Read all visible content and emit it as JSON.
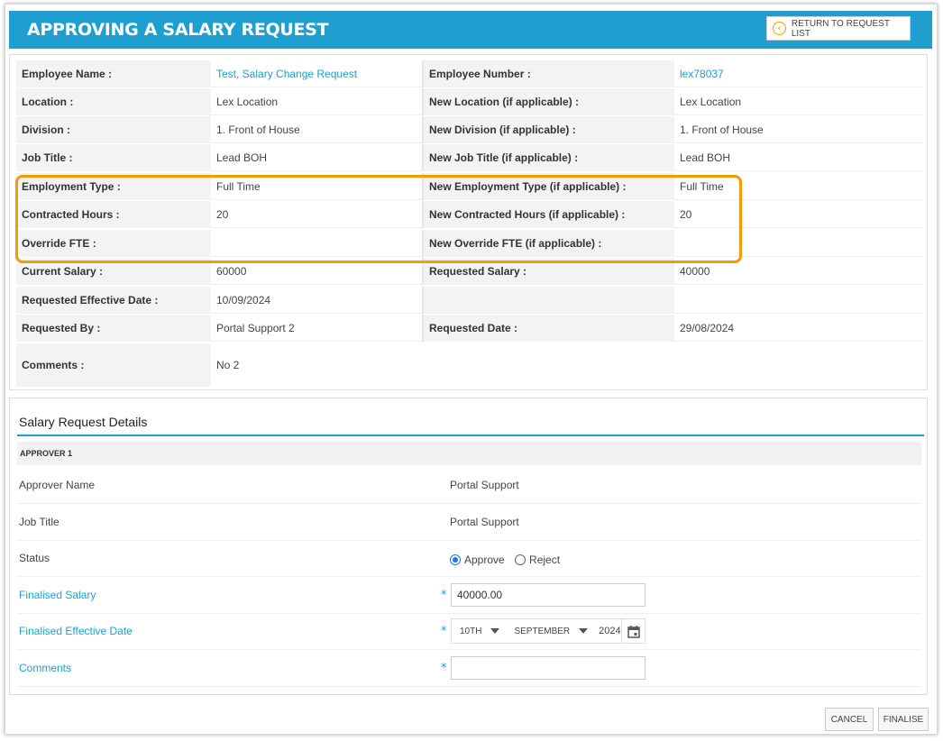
{
  "header": {
    "title": "APPROVING A SALARY REQUEST",
    "return_button": "RETURN TO REQUEST LIST"
  },
  "info": {
    "rows": [
      {
        "l1": "Employee Name :",
        "v1": "Test, Salary Change Request",
        "l2": "Employee Number :",
        "v2": "lex78037"
      },
      {
        "l1": "Location :",
        "v1": "Lex Location",
        "l2": "New Location (if applicable) :",
        "v2": "Lex Location"
      },
      {
        "l1": "Division :",
        "v1": "1. Front of House",
        "l2": "New Division (if applicable) :",
        "v2": "1. Front of House"
      },
      {
        "l1": "Job Title :",
        "v1": "Lead BOH",
        "l2": "New Job Title (if applicable) :",
        "v2": "Lead BOH"
      },
      {
        "l1": "Employment Type :",
        "v1": "Full Time",
        "l2": "New Employment Type (if applicable) :",
        "v2": "Full Time"
      },
      {
        "l1": "Contracted Hours :",
        "v1": "20",
        "l2": "New Contracted Hours (if applicable) :",
        "v2": "20"
      },
      {
        "l1": "Override FTE :",
        "v1": "",
        "l2": "New Override FTE (if applicable) :",
        "v2": ""
      },
      {
        "l1": "Current Salary :",
        "v1": "60000",
        "l2": "Requested Salary :",
        "v2": "40000"
      },
      {
        "l1": "Requested Effective Date :",
        "v1": "10/09/2024",
        "l2": "",
        "v2": ""
      },
      {
        "l1": "Requested By :",
        "v1": "Portal Support 2",
        "l2": "Requested Date :",
        "v2": "29/08/2024"
      },
      {
        "l1": "Comments :",
        "v1": "No 2",
        "l2": "",
        "v2": ""
      }
    ]
  },
  "details": {
    "title": "Salary Request Details",
    "approver_band": "APPROVER 1",
    "approver_name_label": "Approver Name",
    "approver_name": "Portal Support",
    "job_title_label": "Job Title",
    "job_title": "Portal Support",
    "status_label": "Status",
    "approve_label": "Approve",
    "reject_label": "Reject",
    "finalised_salary_label": "Finalised Salary",
    "finalised_salary": "40000.00",
    "finalised_date_label": "Finalised Effective Date",
    "date_day": "10TH",
    "date_month": "SEPTEMBER",
    "date_year": "2024",
    "comments_label": "Comments",
    "comments_value": "",
    "required_mark": "*"
  },
  "footer": {
    "cancel": "CANCEL",
    "finalise": "FINALISE"
  },
  "colors": {
    "header": "#1e9fcf",
    "highlight": "#f59a0b",
    "link": "#1e9fcf"
  }
}
